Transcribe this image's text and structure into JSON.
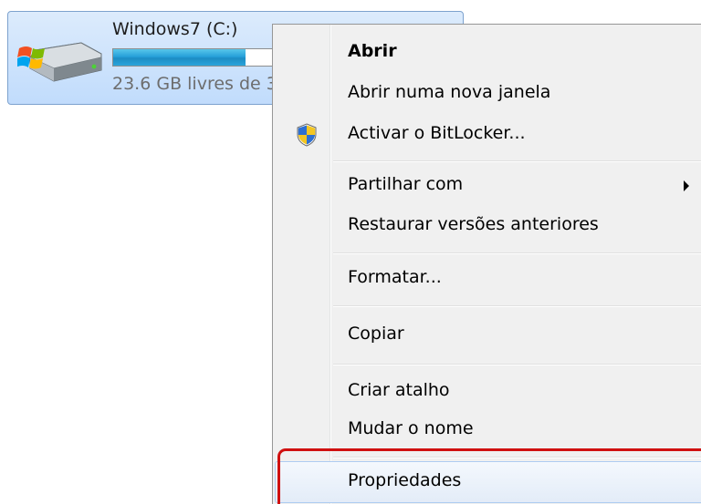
{
  "drive": {
    "name": "Windows7 (C:)",
    "free_text": "23.6 GB livres de 3",
    "usage_fraction": 0.73,
    "icon": "hard-drive-icon"
  },
  "context_menu": {
    "items": [
      {
        "label": "Abrir",
        "bold": true
      },
      {
        "label": "Abrir numa nova janela"
      },
      {
        "label": "Activar o BitLocker...",
        "icon": "uac-shield-icon"
      },
      {
        "label": "Partilhar com",
        "submenu": true
      },
      {
        "label": "Restaurar versões anteriores"
      },
      {
        "label": "Formatar..."
      },
      {
        "label": "Copiar"
      },
      {
        "label": "Criar atalho"
      },
      {
        "label": "Mudar o nome"
      },
      {
        "label": "Propriedades",
        "highlighted": true
      }
    ]
  },
  "colors": {
    "selection_border": "#7da2ce",
    "highlight_box": "#d01010",
    "bar_fill": "#26a0da"
  }
}
